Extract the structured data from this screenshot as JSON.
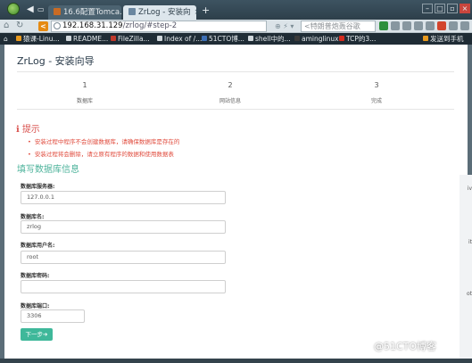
{
  "browser": {
    "tabs": [
      {
        "title": "16.6配置Tomca...",
        "active": false
      },
      {
        "title": "ZrLog - 安装向",
        "active": true
      }
    ],
    "url_host": "192.168.31.129",
    "url_path": "/zrlog/#step-2",
    "search_placeholder": "<特朗普炮轰谷歌",
    "bookmarks": [
      "猿课-Linu...",
      "README...",
      "FileZilla...",
      "Index of /...",
      "51CTO博...",
      "shell中的...",
      "aminglinux",
      "TCP的3...",
      "发送到手机"
    ]
  },
  "page": {
    "brand": "ZrLog - 安装向导",
    "steps": [
      {
        "num": "1",
        "label": "数据库"
      },
      {
        "num": "2",
        "label": "网站信息"
      },
      {
        "num": "3",
        "label": "完成"
      }
    ],
    "tip_icon": "ℹ",
    "tip_title": "提示",
    "tips": [
      "安装过程中程序不会创建数据库，请确保数据库是存在的",
      "安装过程将会删除，请立原有程序的数据和使用数据表"
    ],
    "section_title": "填写数据库信息",
    "fields": [
      {
        "label": "数据库服务器:",
        "value": "127.0.0.1"
      },
      {
        "label": "数据库名:",
        "value": "zrlog"
      },
      {
        "label": "数据库用户名:",
        "value": "root"
      },
      {
        "label": "数据库密码:",
        "value": ""
      },
      {
        "label": "数据库端口:",
        "value": "3306"
      }
    ],
    "next_button": "下一步➔"
  },
  "watermark": "@51CTO博客",
  "colors": {
    "accent": "#3fb89a",
    "warning": "#d9534f"
  }
}
